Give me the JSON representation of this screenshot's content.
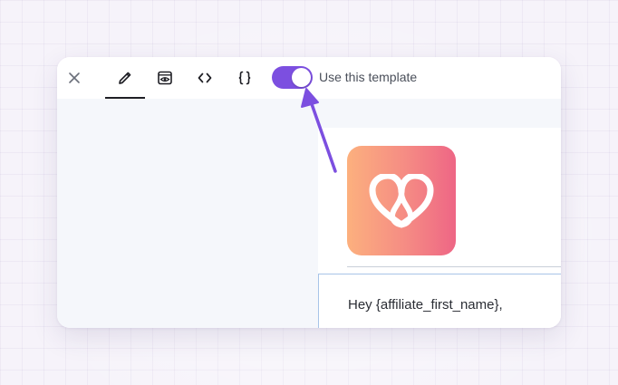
{
  "toolbar": {
    "close_icon": "close-icon",
    "tabs": [
      {
        "name": "edit",
        "icon": "pencil-icon",
        "active": true
      },
      {
        "name": "preview",
        "icon": "eye-window-icon",
        "active": false
      },
      {
        "name": "code",
        "icon": "code-brackets-icon",
        "active": false
      },
      {
        "name": "variables",
        "icon": "curly-braces-icon",
        "active": false
      }
    ],
    "toggle": {
      "on": true,
      "label": "Use this template"
    }
  },
  "email": {
    "logo_icon": "heart-loop-logo",
    "greeting": "Hey {affiliate_first_name},"
  },
  "colors": {
    "accent": "#7c4fe0",
    "logo_gradient_start": "#fcb07e",
    "logo_gradient_end": "#ee6685",
    "sidebar_bg": "#f5f7fb",
    "arrow": "#7c4fe0"
  }
}
